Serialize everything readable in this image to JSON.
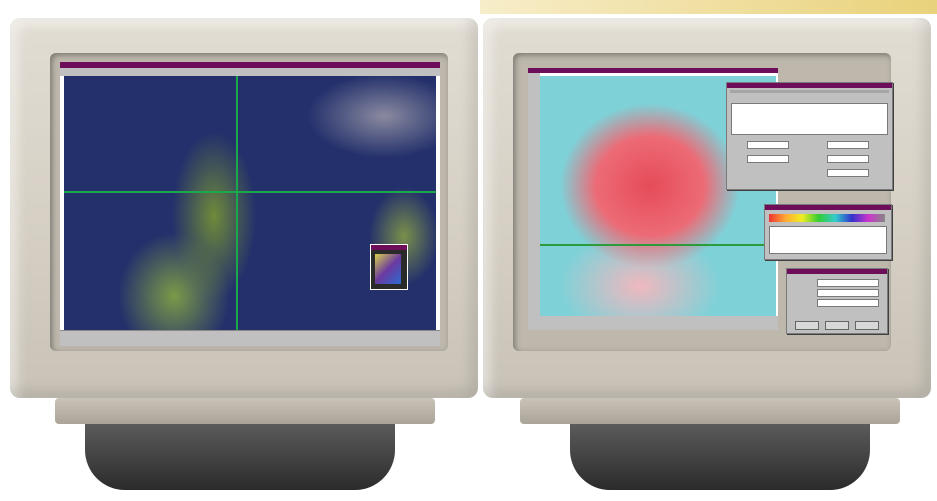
{
  "scene": "two-crt-monitors-gis",
  "left_monitor": {
    "content": "satellite-image",
    "colors": {
      "water": "#23306b",
      "land": "#7c9a48",
      "grid": "#1aa84a",
      "titlebar": "#6e0d5a"
    }
  },
  "right_monitor": {
    "content": "topographic-map",
    "colors": {
      "water": "#7fd1d8",
      "urban": "#e64b59",
      "titlebar": "#6e0d5a"
    }
  }
}
